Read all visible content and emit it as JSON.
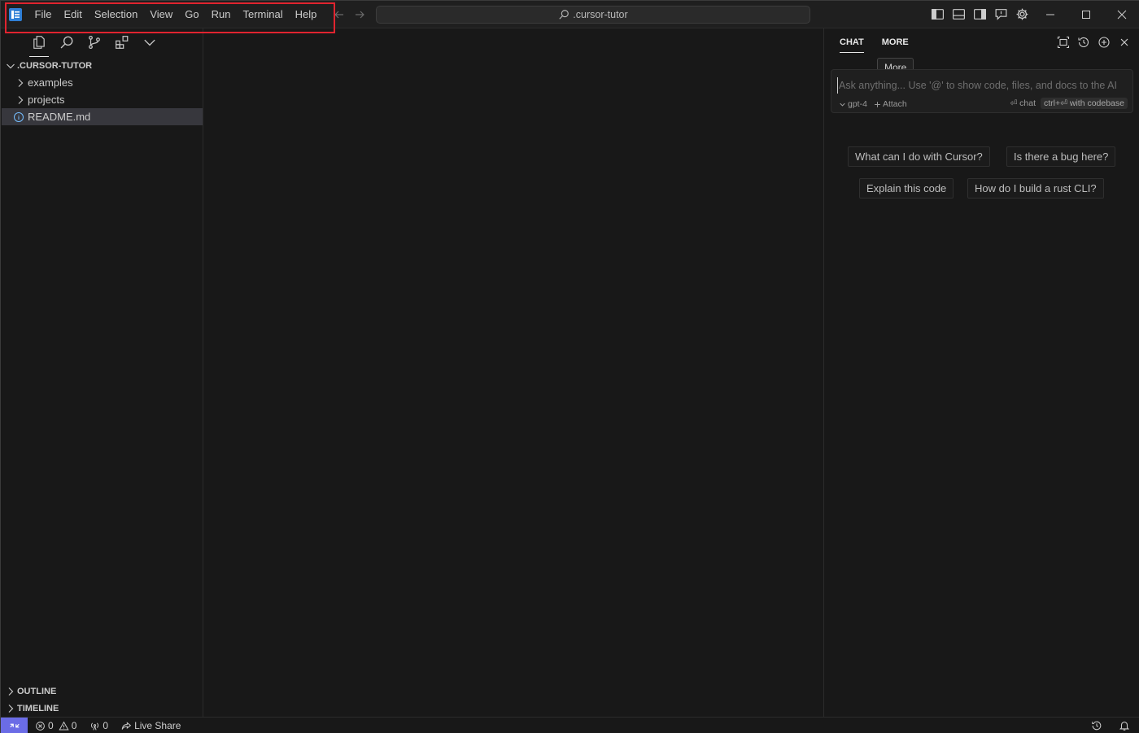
{
  "menubar": {
    "items": [
      "File",
      "Edit",
      "Selection",
      "View",
      "Go",
      "Run",
      "Terminal",
      "Help"
    ]
  },
  "command_center": {
    "text": ".cursor-tutor",
    "icon": "search-icon"
  },
  "explorer": {
    "root_label": ".CURSOR-TUTOR",
    "items": [
      {
        "label": "examples",
        "type": "folder",
        "icon": "chevron-right-icon"
      },
      {
        "label": "projects",
        "type": "folder",
        "icon": "chevron-right-icon"
      },
      {
        "label": "README.md",
        "type": "file",
        "icon": "info-icon",
        "selected": true
      }
    ],
    "sections": [
      "OUTLINE",
      "TIMELINE"
    ]
  },
  "chat": {
    "tabs": [
      "CHAT",
      "MORE"
    ],
    "active_tab": "CHAT",
    "tooltip": "More",
    "input_placeholder": "Ask anything... Use '@' to show code, files, and docs to the AI",
    "model": "gpt-4",
    "attach_label": "Attach",
    "hint_chat": "⏎ chat",
    "hint_codebase": "ctrl+⏎ with codebase",
    "suggestions": [
      "What can I do with Cursor?",
      "Is there a bug here?",
      "Explain this code",
      "How do I build a rust CLI?"
    ]
  },
  "statusbar": {
    "errors": "0",
    "warnings": "0",
    "ports": "0",
    "live_share": "Live Share"
  },
  "colors": {
    "background": "#181818",
    "accent": "#6b6ce6",
    "highlight_box": "#e0242f",
    "selection": "#37373d"
  }
}
